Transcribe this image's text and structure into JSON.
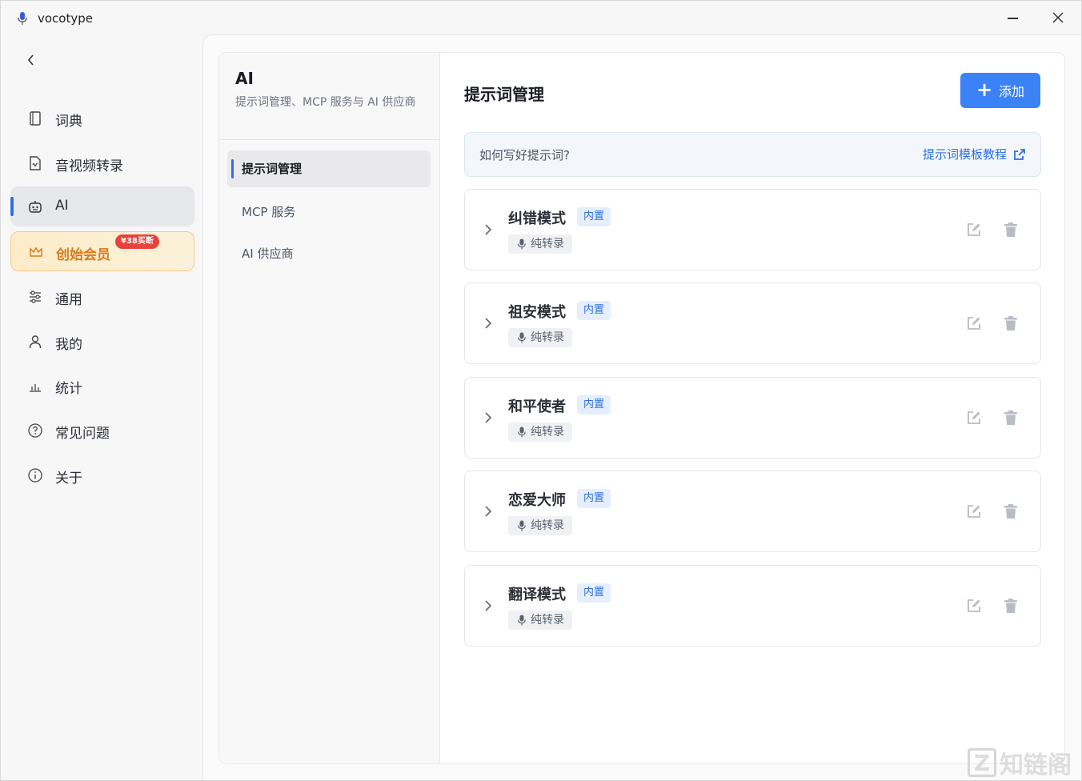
{
  "app": {
    "title": "vocotype"
  },
  "sidebar": {
    "items": [
      {
        "label": "词典",
        "icon": "book-icon"
      },
      {
        "label": "音视频转录",
        "icon": "file-audio-icon"
      },
      {
        "label": "AI",
        "icon": "robot-icon",
        "active": true
      },
      {
        "label": "创始会员",
        "icon": "crown-icon",
        "badge": "¥38买断"
      },
      {
        "label": "通用",
        "icon": "sliders-icon"
      },
      {
        "label": "我的",
        "icon": "user-icon"
      },
      {
        "label": "统计",
        "icon": "chart-icon"
      },
      {
        "label": "常见问题",
        "icon": "question-icon"
      },
      {
        "label": "关于",
        "icon": "info-icon"
      }
    ]
  },
  "sub": {
    "title": "AI",
    "desc": "提示词管理、MCP 服务与 AI 供应商",
    "items": [
      {
        "label": "提示词管理",
        "active": true
      },
      {
        "label": "MCP 服务"
      },
      {
        "label": "AI 供应商"
      }
    ]
  },
  "main": {
    "title": "提示词管理",
    "add_label": "添加",
    "tip_text": "如何写好提示词?",
    "tip_link": "提示词模板教程",
    "prompts": [
      {
        "name": "纠错模式",
        "badge": "内置",
        "tag": "纯转录"
      },
      {
        "name": "祖安模式",
        "badge": "内置",
        "tag": "纯转录"
      },
      {
        "name": "和平使者",
        "badge": "内置",
        "tag": "纯转录"
      },
      {
        "name": "恋爱大师",
        "badge": "内置",
        "tag": "纯转录"
      },
      {
        "name": "翻译模式",
        "badge": "内置",
        "tag": "纯转录"
      }
    ]
  },
  "watermark": {
    "text": "知链阁"
  },
  "colors": {
    "accent": "#3b82f6",
    "vip": "#d97a1a",
    "badge_red": "#e8423d"
  }
}
